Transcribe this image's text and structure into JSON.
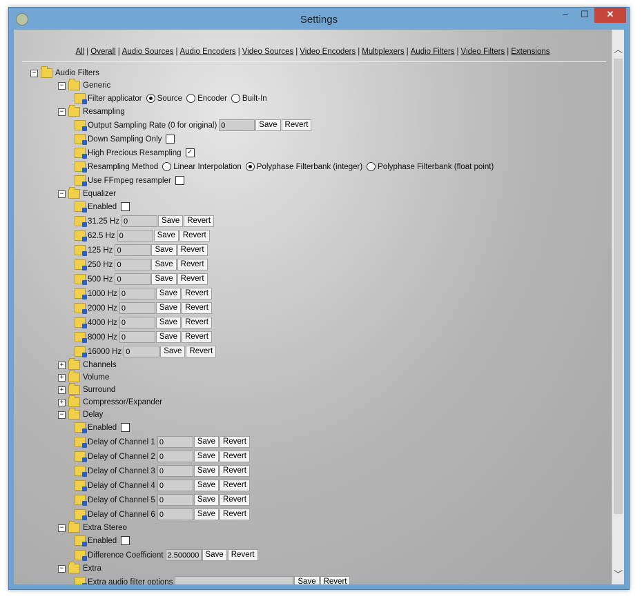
{
  "window": {
    "title": "Settings",
    "minimize": "–",
    "maximize": "☐",
    "close": "✕"
  },
  "nav": [
    "All",
    "Overall",
    "Audio Sources",
    "Audio Encoders",
    "Video Sources",
    "Video Encoders",
    "Multiplexers",
    "Audio Filters",
    "Video Filters",
    "Extensions"
  ],
  "tree": {
    "root": "Audio Filters",
    "generic": {
      "label": "Generic",
      "filter_applicator": "Filter applicator",
      "options": [
        "Source",
        "Encoder",
        "Built-In"
      ],
      "selected": "Source"
    },
    "resampling": {
      "label": "Resampling",
      "output_rate_label": "Output Sampling Rate (0 for original)",
      "output_rate_value": "0",
      "down_sampling_label": "Down Sampling Only",
      "down_sampling_checked": false,
      "high_precious_label": "High Precious Resampling",
      "high_precious_checked": true,
      "method_label": "Resampling Method",
      "methods": [
        "Linear Interpolation",
        "Polyphase Filterbank (integer)",
        "Polyphase Filterbank (float point)"
      ],
      "method_selected": "Polyphase Filterbank (integer)",
      "ffmpeg_label": "Use FFmpeg resampler",
      "ffmpeg_checked": false
    },
    "equalizer": {
      "label": "Equalizer",
      "enabled_label": "Enabled",
      "enabled": false,
      "bands": [
        {
          "label": "31.25 Hz",
          "value": "0"
        },
        {
          "label": "62.5 Hz",
          "value": "0"
        },
        {
          "label": "125 Hz",
          "value": "0"
        },
        {
          "label": "250 Hz",
          "value": "0"
        },
        {
          "label": "500 Hz",
          "value": "0"
        },
        {
          "label": "1000 Hz",
          "value": "0"
        },
        {
          "label": "2000 Hz",
          "value": "0"
        },
        {
          "label": "4000 Hz",
          "value": "0"
        },
        {
          "label": "8000 Hz",
          "value": "0"
        },
        {
          "label": "16000 Hz",
          "value": "0"
        }
      ]
    },
    "collapsed": [
      "Channels",
      "Volume",
      "Surround",
      "Compressor/Expander"
    ],
    "delay": {
      "label": "Delay",
      "enabled_label": "Enabled",
      "enabled": false,
      "channels": [
        {
          "label": "Delay of Channel 1",
          "value": "0"
        },
        {
          "label": "Delay of Channel 2",
          "value": "0"
        },
        {
          "label": "Delay of Channel 3",
          "value": "0"
        },
        {
          "label": "Delay of Channel 4",
          "value": "0"
        },
        {
          "label": "Delay of Channel 5",
          "value": "0"
        },
        {
          "label": "Delay of Channel 6",
          "value": "0"
        }
      ]
    },
    "extra_stereo": {
      "label": "Extra Stereo",
      "enabled_label": "Enabled",
      "enabled": false,
      "coef_label": "Difference Coefficient",
      "coef_value": "2.500000"
    },
    "extra": {
      "label": "Extra",
      "options_label": "Extra audio filter options",
      "options_value": ""
    }
  },
  "buttons": {
    "save": "Save",
    "revert": "Revert"
  },
  "expand_minus": "−",
  "expand_plus": "+"
}
